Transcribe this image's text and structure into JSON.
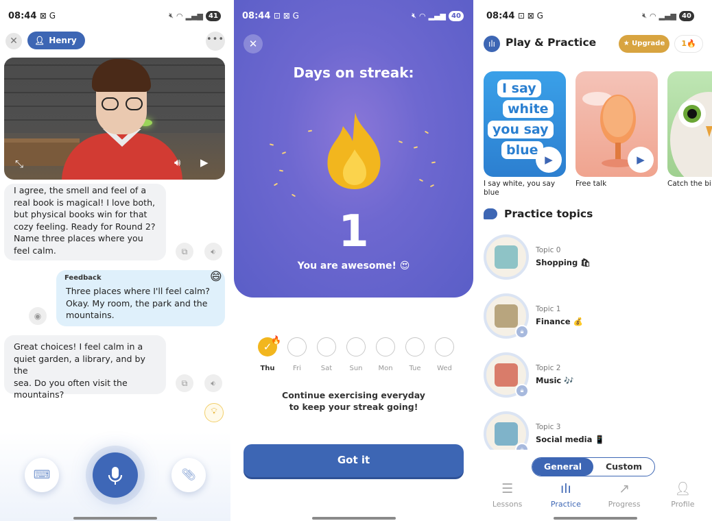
{
  "colors": {
    "brand": "#3d66b4",
    "flame": "#f2b61e",
    "streak_bg": "#6e68d0",
    "user_bubble": "#dff0fb",
    "bot_bubble": "#f1f2f4"
  },
  "screen1": {
    "status": {
      "time": "08:44",
      "extra": "⊠ G",
      "battery": "41"
    },
    "close_icon": "close-icon",
    "tutor_name": "Henry",
    "more_icon": "more-icon",
    "messages": [
      {
        "role": "bot",
        "lines": [
          "I agree, the smell and feel of a",
          "real book is magical! I love both,",
          "but physical books win for that",
          "cozy feeling. Ready for Round 2?",
          "Name three places where you",
          "feel calm."
        ]
      },
      {
        "role": "user",
        "tag": "Feedback",
        "lines": [
          "Three places where I'll feel calm?",
          "Okay. My room, the park and the",
          "mountains."
        ],
        "emoji": "😄"
      },
      {
        "role": "bot",
        "lines": [
          "Great choices! I feel calm in a",
          "quiet garden, a library, and by the",
          "sea. Do you often visit the",
          "mountains?"
        ]
      }
    ]
  },
  "screen2": {
    "status": {
      "time": "08:44",
      "extra": "⊡ ⊠ G",
      "battery": "40"
    },
    "title": "Days on streak:",
    "count": "1",
    "subtitle": "You are awesome! 😍",
    "days": [
      "Thu",
      "Fri",
      "Sat",
      "Sun",
      "Mon",
      "Tue",
      "Wed"
    ],
    "active_day": "Thu",
    "continue_line1": "Continue exercising everyday",
    "continue_line2": "to keep your streak going!",
    "button": "Got it"
  },
  "screen3": {
    "status": {
      "time": "08:44",
      "extra": "⊡ ⊠ G",
      "battery": "40"
    },
    "title": "Play & Practice",
    "upgrade": "★ Upgrade",
    "streak": "1🔥",
    "cards": [
      {
        "title": "I say white, you say blue",
        "words": [
          "I say",
          "white",
          "you say",
          "blue"
        ]
      },
      {
        "title": "Free talk"
      },
      {
        "title": "Catch the bi"
      }
    ],
    "topics_heading": "Practice topics",
    "topics": [
      {
        "label": "Topic 0",
        "name": "Shopping 🛍",
        "locked": false
      },
      {
        "label": "Topic 1",
        "name": "Finance 💰",
        "locked": true
      },
      {
        "label": "Topic 2",
        "name": "Music 🎶",
        "locked": true
      },
      {
        "label": "Topic 3",
        "name": "Social media 📱",
        "locked": true
      }
    ],
    "segments": {
      "general": "General",
      "custom": "Custom",
      "selected": "General"
    },
    "nav": [
      {
        "label": "Lessons",
        "icon": "lessons-icon",
        "active": false
      },
      {
        "label": "Practice",
        "icon": "practice-icon",
        "active": true
      },
      {
        "label": "Progress",
        "icon": "progress-icon",
        "active": false
      },
      {
        "label": "Profile",
        "icon": "profile-icon",
        "active": false
      }
    ]
  }
}
